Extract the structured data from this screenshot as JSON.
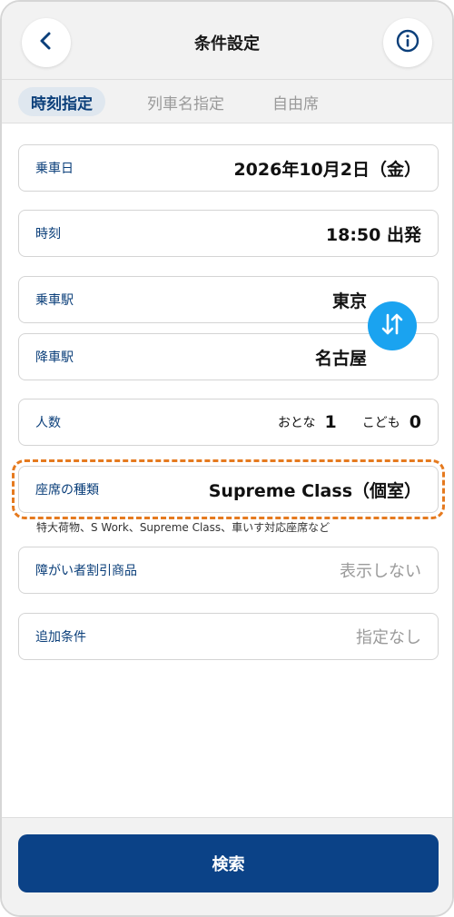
{
  "header": {
    "title": "条件設定",
    "back_icon": "chevron-left-icon",
    "info_icon": "info-icon"
  },
  "tabs": [
    {
      "label": "時刻指定",
      "active": true
    },
    {
      "label": "列車名指定",
      "active": false
    },
    {
      "label": "自由席",
      "active": false
    }
  ],
  "form": {
    "date": {
      "label": "乗車日",
      "value": "2026年10月2日（金）"
    },
    "time": {
      "label": "時刻",
      "value": "18:50 出発"
    },
    "from": {
      "label": "乗車駅",
      "value": "東京"
    },
    "to": {
      "label": "降車駅",
      "value": "名古屋"
    },
    "people": {
      "label": "人数",
      "adult_label": "おとな",
      "adult_count": "1",
      "child_label": "こども",
      "child_count": "0"
    },
    "seat": {
      "label": "座席の種類",
      "value": "Supreme Class（個室）",
      "note": "特大荷物、S Work、Supreme Class、車いす対応座席など"
    },
    "discount": {
      "label": "障がい者割引商品",
      "value": "表示しない"
    },
    "extra": {
      "label": "追加条件",
      "value": "指定なし"
    }
  },
  "swap_icon": "swap-vertical-icon",
  "footer": {
    "search_label": "検索"
  },
  "colors": {
    "primary": "#0b4287",
    "accent": "#1aa3f0",
    "highlight": "#e57a1f",
    "label": "#0b3f7a"
  }
}
